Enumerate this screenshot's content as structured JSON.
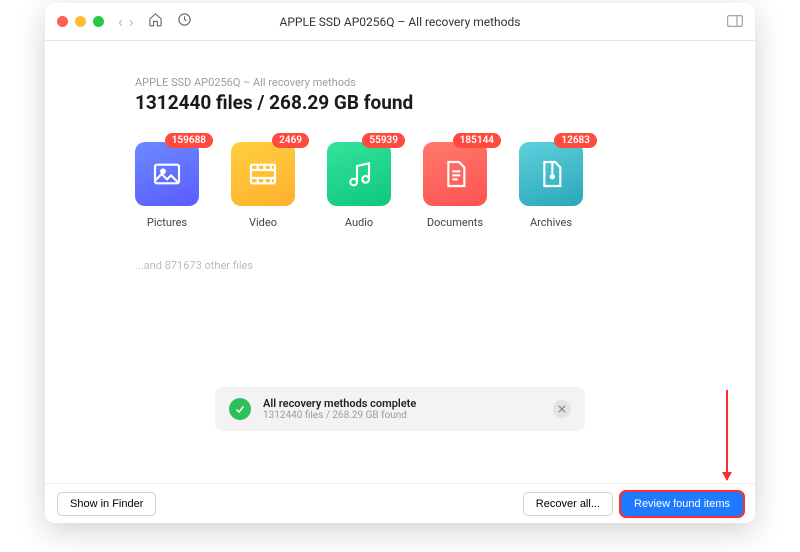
{
  "window": {
    "title": "APPLE SSD AP0256Q – All recovery methods"
  },
  "summary": {
    "crumb": "APPLE SSD AP0256Q – All recovery methods",
    "headline": "1312440 files / 268.29 GB found"
  },
  "categories": [
    {
      "name": "Pictures",
      "badge": "159688",
      "gradient": "g-pic"
    },
    {
      "name": "Video",
      "badge": "2469",
      "gradient": "g-vid"
    },
    {
      "name": "Audio",
      "badge": "55939",
      "gradient": "g-aud"
    },
    {
      "name": "Documents",
      "badge": "185144",
      "gradient": "g-doc"
    },
    {
      "name": "Archives",
      "badge": "12683",
      "gradient": "g-arc"
    }
  ],
  "others": "...and 871673 other files",
  "status": {
    "line1": "All recovery methods complete",
    "line2": "1312440 files / 268.29 GB found"
  },
  "footer": {
    "show_in_finder": "Show in Finder",
    "recover_all": "Recover all...",
    "review": "Review found items"
  }
}
